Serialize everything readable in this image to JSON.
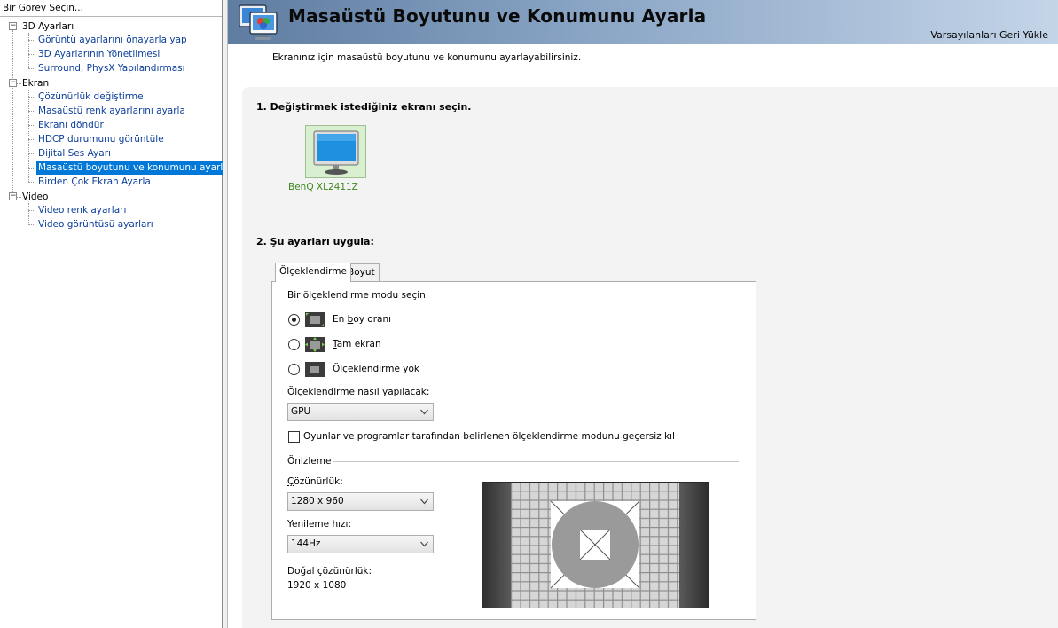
{
  "sidebar": {
    "title": "Bir Görev Seçin...",
    "groups": [
      {
        "label": "3D Ayarları",
        "expander": "−",
        "items": [
          "Görüntü ayarlarını önayarla yap",
          "3D Ayarlarının Yönetilmesi",
          "Surround, PhysX Yapılandırması"
        ]
      },
      {
        "label": "Ekran",
        "expander": "−",
        "items": [
          "Çözünürlük değiştirme",
          "Masaüstü renk ayarlarını ayarla",
          "Ekranı döndür",
          "HDCP durumunu görüntüle",
          "Dijital Ses Ayarı",
          "Masaüstü boyutunu ve konumunu ayarla",
          "Birden Çok Ekran Ayarla"
        ]
      },
      {
        "label": "Video",
        "expander": "−",
        "items": [
          "Video renk ayarları",
          "Video görüntüsü ayarları"
        ]
      }
    ],
    "selected_item": "Masaüstü boyutunu ve konumunu ayarla"
  },
  "header": {
    "title": "Masaüstü Boyutunu ve Konumunu Ayarla",
    "restore_defaults": "Varsayılanları Geri Yükle"
  },
  "description": "Ekranınız için masaüstü boyutunu ve konumunu ayarlayabilirsiniz.",
  "step1": {
    "heading": "1. Değiştirmek istediğiniz ekranı seçin.",
    "display_name": "BenQ XL2411Z",
    "display_icon": "monitor-icon"
  },
  "step2": {
    "heading": "2. Şu ayarları uygula:",
    "tabs": [
      "Ölçeklendirme",
      "Boyut"
    ],
    "active_tab": "Ölçeklendirme",
    "mode_prompt": "Bir ölçeklendirme modu seçin:",
    "modes": [
      {
        "pre": "En ",
        "ul": "b",
        "post": "oy oranı",
        "selected": true
      },
      {
        "pre": "",
        "ul": "T",
        "post": "am ekran",
        "selected": false
      },
      {
        "pre": "Ölçe",
        "ul": "k",
        "post": "lendirme yok",
        "selected": false
      }
    ],
    "method_label": "Ölçeklendirme nasıl yapılacak:",
    "method_value": "GPU",
    "override_label": "Oyunlar ve programlar tarafından belirlenen ölçeklendirme modunu geçersiz kıl",
    "override_checked": false,
    "preview_group": "Önizleme",
    "resolution_label": "Çözünürlük:",
    "resolution_value": "1280 x 960",
    "refresh_label": "Yenileme hızı:",
    "refresh_value": "144Hz",
    "native_label": "Doğal çözünürlük:",
    "native_value": "1920 x 1080"
  },
  "colors": {
    "selection": "#0078d7",
    "tree_link": "#0b3e9a",
    "display_label": "#3d8a1d",
    "banner_start": "#5f7da1",
    "banner_end": "#c4d5e8"
  }
}
